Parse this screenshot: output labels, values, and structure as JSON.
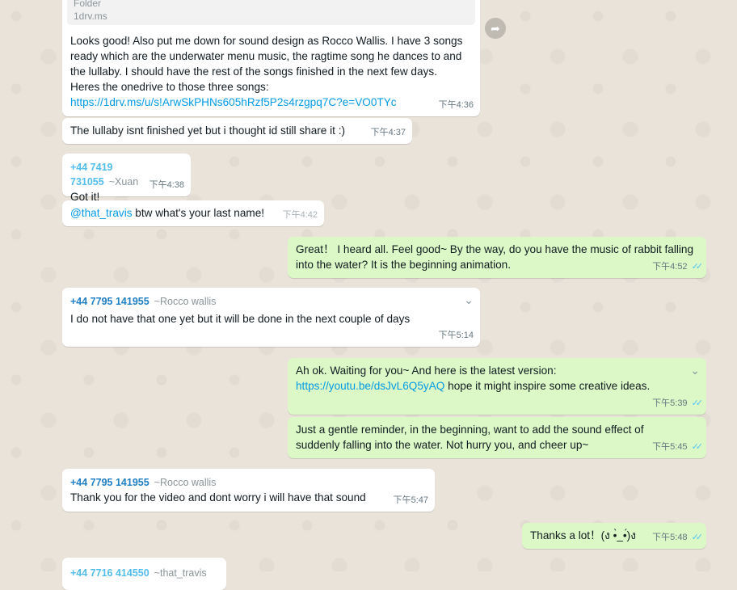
{
  "link_preview": {
    "title_partial": "Folder",
    "domain": "1drv.ms"
  },
  "messages": [
    {
      "text_before": "Looks good! Also put me down for sound design as Rocco Wallis. I have 3 songs ready which are the underwater menu music, the ragtime song he dances to and the lullaby. I should have the rest of the songs finished in the next few days. Heres the onedrive to those three songs:",
      "link": "https://1drv.ms/u/s!ArwSkPHNs605hRzf5P2s4rzgpq7C?e=VO0TYc",
      "time": "下午4:36"
    },
    {
      "text": "The lullaby isnt finished yet but i thought id still share it :)",
      "time": "下午4:37"
    },
    {
      "sender_number": "+44 7419 731055",
      "sender_alias": "~Xuan",
      "text": "Got it!",
      "time": "下午4:38"
    },
    {
      "mention": "@that_travis",
      "text": " btw what's your last name!",
      "time": "下午4:42"
    },
    {
      "text": "Great！ I heard all. Feel good~ By the way, do you have the music of rabbit falling into the water? It is the beginning animation.",
      "time": "下午4:52"
    },
    {
      "sender_number": "+44 7795 141955",
      "sender_alias": "~Rocco wallis",
      "text": "I do not have that one yet but it will be done in the next couple of days",
      "time": "下午5:14"
    },
    {
      "text_before": "Ah ok. Waiting for you~ And here is the latest version: ",
      "link": "https://youtu.be/dsJvL6Q5yAQ",
      "text_after": " hope it might inspire some creative ideas.",
      "time": "下午5:39"
    },
    {
      "text": "Just a gentle reminder, in the beginning, want to add the sound effect of suddenly falling into the water. Not hurry you, and cheer up~",
      "time": "下午5:45"
    },
    {
      "sender_number": "+44 7795 141955",
      "sender_alias": "~Rocco wallis",
      "text": "Thank you for the video and dont worry i will have that sound",
      "time": "下午5:47"
    },
    {
      "text": "Thanks a lot！(ง •̀_•́)ง",
      "time": "下午5:48"
    },
    {
      "sender_number_partial": "+44 7716 414550",
      "sender_alias_partial": "~that_travis"
    }
  ],
  "icons": {
    "forward": "forward-icon",
    "chevron": "chevron-down-icon",
    "read_ticks": "double-check-icon"
  },
  "colors": {
    "incoming": "#ffffff",
    "outgoing": "#dcf8c6",
    "link": "#039be5",
    "ticks": "#4fc3f7"
  }
}
